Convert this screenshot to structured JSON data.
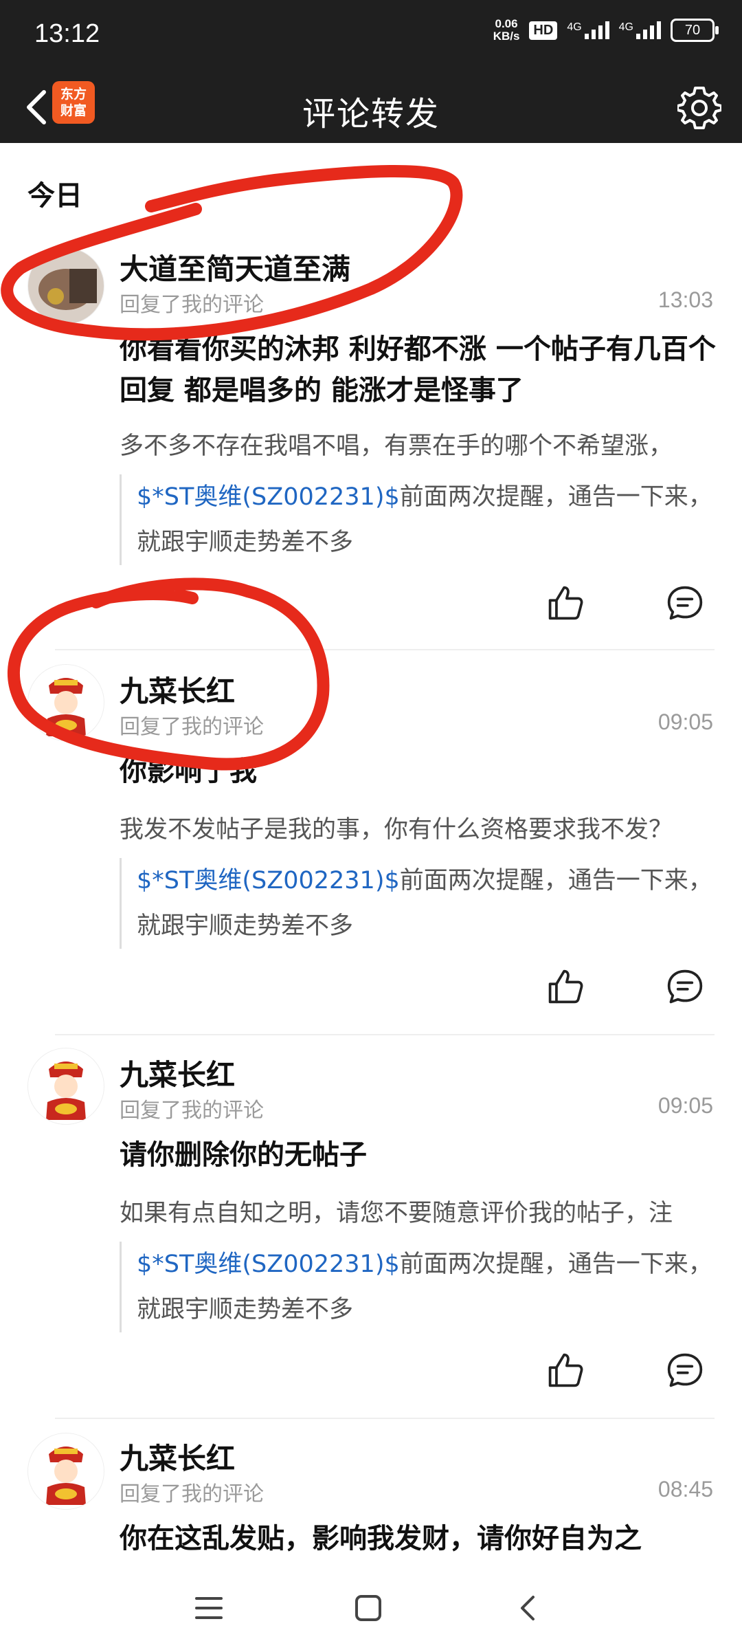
{
  "status_bar": {
    "time": "13:12",
    "net_speed_value": "0.06",
    "net_speed_unit": "KB/s",
    "hd_label": "HD",
    "net1_label": "4G",
    "net2_label": "4G",
    "battery": "70"
  },
  "header": {
    "title": "评论转发",
    "logo_line1": "东方",
    "logo_line2": "财富"
  },
  "section": {
    "label": "今日"
  },
  "colors": {
    "accent_red": "#e62a1b",
    "link_blue": "#1f66c2",
    "header_bg": "#1f1f1f",
    "logo_orange": "#f15a22"
  },
  "items": [
    {
      "username": "大道至简天道至满",
      "subtitle": "回复了我的评论",
      "time": "13:03",
      "reply": "你看看你买的沐邦 利好都不涨 一个帖子有几百个回复 都是唱多的 能涨才是怪事了",
      "my_comment": "多不多不存在我唱不唱，有票在手的哪个不希望涨，",
      "quote_stock": "$*ST奥维(SZ002231)$",
      "quote_text": "前面两次提醒，通告一下来，就跟宇顺走势差不多",
      "avatar_icon": "photo-avatar"
    },
    {
      "username": "九菜长红",
      "subtitle": "回复了我的评论",
      "time": "09:05",
      "reply": "你影响了我",
      "my_comment": "我发不发帖子是我的事，你有什么资格要求我不发？",
      "quote_stock": "$*ST奥维(SZ002231)$",
      "quote_text": "前面两次提醒，通告一下来，就跟宇顺走势差不多",
      "avatar_icon": "fortune-god-avatar"
    },
    {
      "username": "九菜长红",
      "subtitle": "回复了我的评论",
      "time": "09:05",
      "reply": "请你删除你的无帖子",
      "my_comment": "如果有点自知之明，请您不要随意评价我的帖子，注",
      "quote_stock": "$*ST奥维(SZ002231)$",
      "quote_text": "前面两次提醒，通告一下来，就跟宇顺走势差不多",
      "avatar_icon": "fortune-god-avatar"
    },
    {
      "username": "九菜长红",
      "subtitle": "回复了我的评论",
      "time": "08:45",
      "reply": "你在这乱发贴，影响我发财，请你好自为之",
      "avatar_icon": "fortune-god-avatar"
    }
  ],
  "nav": {
    "menu_icon": "menu-icon",
    "home_icon": "home-square-icon",
    "back_icon": "back-chevron-icon"
  }
}
